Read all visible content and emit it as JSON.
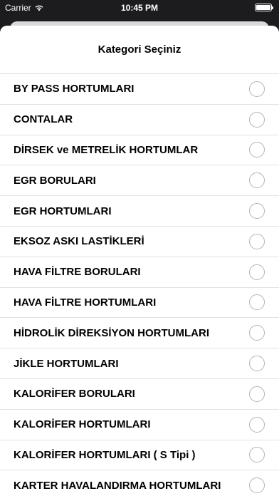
{
  "status_bar": {
    "carrier": "Carrier",
    "time": "10:45 PM"
  },
  "sheet": {
    "title": "Kategori Seçiniz",
    "items": [
      {
        "label": "BY PASS HORTUMLARI",
        "selected": false
      },
      {
        "label": "CONTALAR",
        "selected": false
      },
      {
        "label": "DİRSEK ve METRELİK HORTUMLAR",
        "selected": false
      },
      {
        "label": "EGR BORULARI",
        "selected": false
      },
      {
        "label": "EGR HORTUMLARI",
        "selected": false
      },
      {
        "label": "EKSOZ ASKI LASTİKLERİ",
        "selected": false
      },
      {
        "label": "HAVA FİLTRE BORULARI",
        "selected": false
      },
      {
        "label": "HAVA FİLTRE HORTUMLARI",
        "selected": false
      },
      {
        "label": "HİDROLİK DİREKSİYON HORTUMLARI",
        "selected": false
      },
      {
        "label": "JİKLE HORTUMLARI",
        "selected": false
      },
      {
        "label": "KALORİFER BORULARI",
        "selected": false
      },
      {
        "label": "KALORİFER HORTUMLARI",
        "selected": false
      },
      {
        "label": "KALORİFER HORTUMLARI ( S Tipi )",
        "selected": false
      },
      {
        "label": "KARTER HAVALANDIRMA HORTUMLARI",
        "selected": false
      }
    ]
  }
}
